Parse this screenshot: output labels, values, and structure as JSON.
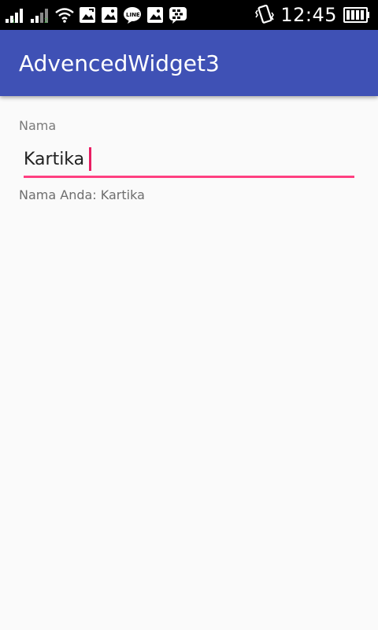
{
  "status_bar": {
    "time": "12:45",
    "icons": [
      "signal-icon",
      "signal-2-icon",
      "wifi-icon",
      "image-edit-icon",
      "image-icon",
      "line-icon",
      "image-icon",
      "bbm-icon",
      "vibrate-icon",
      "battery-icon"
    ]
  },
  "app_bar": {
    "title": "AdvencedWidget3"
  },
  "form": {
    "label": "Nama",
    "input_value": "Kartika",
    "result_text": "Nama Anda: Kartika"
  },
  "colors": {
    "primary": "#3f51b5",
    "accent": "#ff4081",
    "background": "#fafafa"
  }
}
